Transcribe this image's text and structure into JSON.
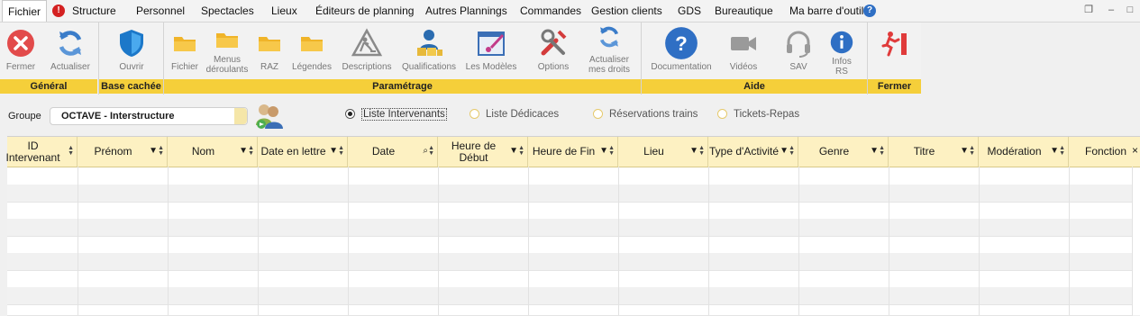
{
  "menu": {
    "items": [
      "Fichier",
      "Structure",
      "Personnel",
      "Spectacles",
      "Lieux",
      "Éditeurs de planning",
      "Autres Plannings",
      "Commandes",
      "Gestion clients",
      "GDS",
      "Bureautique",
      "Ma barre d'outils"
    ],
    "alert_icon": "!",
    "help_icon": "?"
  },
  "window_controls": {
    "restore": "❐",
    "minimize": "–",
    "maximize": "□"
  },
  "ribbon": {
    "buttons": [
      {
        "label": "Fermer",
        "icon": "close-circle-icon"
      },
      {
        "label": "Actualiser",
        "icon": "refresh-icon"
      },
      {
        "label": "Ouvrir",
        "icon": "shield-icon"
      },
      {
        "label": "Fichier",
        "icon": "folder-icon"
      },
      {
        "label": "Menus\ndéroulants",
        "icon": "folder-icon"
      },
      {
        "label": "RAZ",
        "icon": "folder-icon"
      },
      {
        "label": "Légendes",
        "icon": "folder-icon"
      },
      {
        "label": "Descriptions",
        "icon": "construction-icon"
      },
      {
        "label": "Qualifications",
        "icon": "user-boxes-icon"
      },
      {
        "label": "Les Modèles",
        "icon": "paint-window-icon"
      },
      {
        "label": "Options",
        "icon": "tools-icon"
      },
      {
        "label": "Actualiser\nmes droits",
        "icon": "refresh-icon"
      },
      {
        "label": "Documentation",
        "icon": "help-circle-icon"
      },
      {
        "label": "Vidéos",
        "icon": "video-camera-icon"
      },
      {
        "label": "SAV",
        "icon": "headset-icon"
      },
      {
        "label": "Infos\nRS",
        "icon": "info-icon"
      },
      {
        "label": "",
        "icon": "exit-icon"
      }
    ],
    "groups": [
      "Général",
      "Base cachée",
      "Paramétrage",
      "Aide",
      "Fermer"
    ]
  },
  "filters": {
    "group_label": "Groupe",
    "group_value": "OCTAVE - Interstructure",
    "radios": [
      "Liste Intervenants",
      "Liste Dédicaces",
      "Réservations trains",
      "Tickets-Repas"
    ],
    "selected_index": 0
  },
  "grid": {
    "columns": [
      "ID\nIntervenant",
      "Prénom",
      "Nom",
      "Date en lettre",
      "Date",
      "Heure de\nDébut",
      "Heure de Fin",
      "Lieu",
      "Type d'Activité",
      "Genre",
      "Titre",
      "Modération",
      "Fonction"
    ],
    "close_glyph": "×"
  },
  "colors": {
    "accent_yellow": "#f5cf3a",
    "header_yellow": "#fdf1c2",
    "red": "#e03b3b",
    "blue": "#2f6fc4"
  }
}
